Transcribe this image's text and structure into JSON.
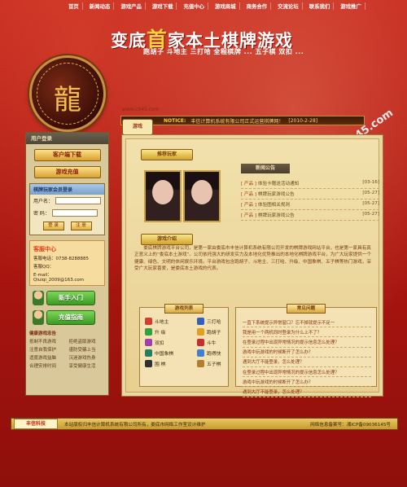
{
  "nav": [
    "首页",
    "新闻动态",
    "游戏产品",
    "游戏下载",
    "充值中心",
    "游戏商城",
    "商务合作",
    "交流论坛",
    "联系我们",
    "游戏推广"
  ],
  "header": {
    "title_pre": "变底",
    "title_big": "首",
    "title_post": "家本土棋牌游戏",
    "games": "跑胡子    斗地主    三打哈    全程棋牌    ...    五子棋 双扣 ...",
    "watermark": "c945.com"
  },
  "notice_bar": {
    "url": "www.c945.com",
    "badge": "游戏",
    "label": "NOTICE:",
    "text": "丰信计算机系统有限公司正式运营棋牌网！",
    "date": "[2010-2-28]"
  },
  "left": {
    "header": "用户登录",
    "client_download": "客户端下载",
    "game_recharge": "游戏充值",
    "login_title": "棋牌玩家会员登录",
    "username_label": "用户名：",
    "password_label": "密  码：",
    "login_btn": "登 录",
    "register_btn": "注 册",
    "service_title": "客服中心",
    "service_phone": "客服电话：0738-8288885",
    "service_qq": "客服QQ：",
    "service_email": "E-mail：Qiuiqi_2009@163.com",
    "newbie_btn": "新手入门",
    "recharge_btn": "充值指南",
    "health_title": "健康游戏忠告",
    "health": [
      "抵制不良游戏",
      "拒绝盗版游戏",
      "注意自我保护",
      "谨防受骗上当",
      "适度游戏益脑",
      "沉迷游戏伤身",
      "合理安排时间",
      "享受健康生活"
    ]
  },
  "main": {
    "players_title": "推荐玩家",
    "notice_title": "新闻公告",
    "news": [
      {
        "cat": "[ 产品 ]",
        "title": "体验卡赠送活动通知",
        "date": "[03-16]"
      },
      {
        "cat": "[ 产品 ]",
        "title": "棋牌玩家游戏公告",
        "date": "[05-27]"
      },
      {
        "cat": "[ 产品 ]",
        "title": "体验图相关规则",
        "date": "[05-27]"
      },
      {
        "cat": "[ 产品 ]",
        "title": "棋牌玩家游戏公告",
        "date": "[05-27]"
      }
    ],
    "intro_title": "游戏介绍",
    "intro_text": "娄底棋牌游戏平台公司，是第一家由娄底市丰信计算机系统有限公司开发的棋牌游戏网站平台，也是第一家具有真正意义上的“娄底本土游戏”。公司依托强大的研发实力及本地化优势推出的本地化棋牌游戏平台，为广大玩家提供一个健康、绿色、文明的休闲娱乐环境。平台游戏包含跑胡子、斗地主、三打哈、升级、中国象棋、五子棋等热门游戏，深受广大玩家喜爱，是娄底本土游戏的代表。",
    "games_title": "游戏列表",
    "games": [
      "斗地主",
      "三打哈",
      "升 级",
      "跑胡子",
      "双扣",
      "斗牛",
      "中国象棋",
      "跑得快",
      "围 棋",
      "五子棋"
    ],
    "qa_title": "常见问题",
    "qa": [
      "一直下系统提示异常窗口？忘不掉就提示不足一",
      "我是用一个两机同时登录为什么上不了？",
      "在登录过程中出现异常情况的提示信息怎么处理？",
      "游戏中玩游戏的时候断开了怎么办？",
      "遇到大厅不能登录，怎么处理？",
      "在登录过程中出现异常情况的提示信息怎么处理？",
      "游戏中玩游戏的时候断开了怎么办？",
      "遇到大厅不能登录，怎么处理？"
    ]
  },
  "footer": {
    "logo": "丰信科技",
    "text": "本站版权归丰信计算机系统有限公司所有，娄底市网络工作室设计维护",
    "right": "网络信息备案号：湘ICP备09036145号"
  },
  "colors": {
    "primary_red": "#b51a14",
    "gold": "#d8a230",
    "panel": "#e9d7a4"
  }
}
